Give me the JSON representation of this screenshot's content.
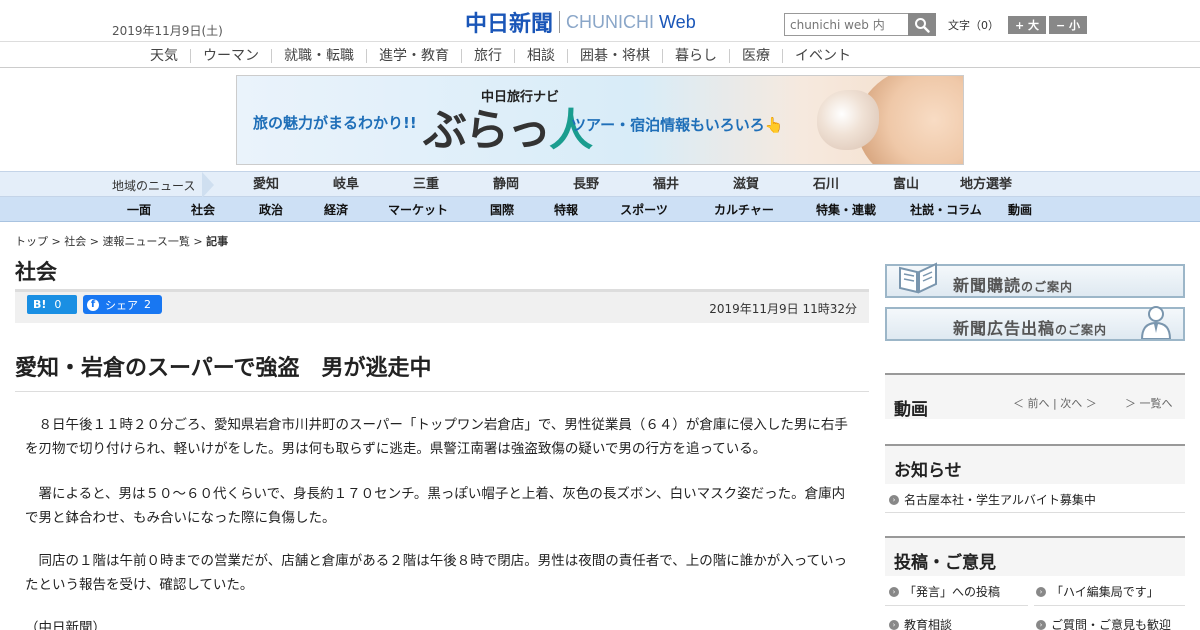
{
  "header": {
    "date": "2019年11月9日(土)",
    "logo_jp": "中日新聞",
    "logo_en_1": "CHUNICHI ",
    "logo_en_2": "Web",
    "search_placeholder": "chunichi web 内",
    "font_label": "文字（0）",
    "font_bigger": "+ 大",
    "font_smaller": "− 小"
  },
  "categories": [
    "天気",
    "ウーマン",
    "就職・転職",
    "進学・教育",
    "旅行",
    "相談",
    "囲碁・将棋",
    "暮らし",
    "医療",
    "イベント"
  ],
  "banner": {
    "subtitle": "中日旅行ナビ",
    "left_text": "旅の魅力がまるわかり!!",
    "logo": "ぶらっ",
    "logo_accent": "人",
    "right_text": "ツアー・宿泊情報もいろいろ👆"
  },
  "region_nav": {
    "label": "地域のニュース",
    "items": [
      "愛知",
      "岐阜",
      "三重",
      "静岡",
      "長野",
      "福井",
      "滋賀",
      "石川",
      "富山",
      "地方選挙"
    ]
  },
  "section_nav": {
    "items": [
      "一面",
      "社会",
      "政治",
      "経済",
      "マーケット",
      "国際",
      "特報",
      "スポーツ",
      "カルチャー",
      "特集・連載",
      "社説・コラム",
      "動画"
    ]
  },
  "article": {
    "breadcrumb": [
      "トップ",
      "社会",
      "速報ニュース一覧",
      "記事"
    ],
    "section": "社会",
    "hatena_label": "B!",
    "hatena_count": "0",
    "facebook_label": "シェア",
    "facebook_count": "2",
    "timestamp": "2019年11月9日 11時32分",
    "headline": "愛知・岩倉のスーパーで強盗　男が逃走中",
    "paragraphs": [
      "　８日午後１１時２０分ごろ、愛知県岩倉市川井町のスーパー「トップワン岩倉店」で、男性従業員（６４）が倉庫に侵入した男に右手を刃物で切り付けられ、軽いけがをした。男は何も取らずに逃走。県警江南署は強盗致傷の疑いで男の行方を追っている。",
      "　署によると、男は５０～６０代くらいで、身長約１７０センチ。黒っぽい帽子と上着、灰色の長ズボン、白いマスク姿だった。倉庫内で男と鉢合わせ、もみ合いになった際に負傷した。",
      "　同店の１階は午前０時までの営業だが、店舗と倉庫がある２階は午後８時で閉店。男性は夜間の責任者で、上の階に誰かが入っていったという報告を受け、確認していた。",
      "（中日新聞）"
    ]
  },
  "sidebar": {
    "banner1_main": "新聞購読",
    "banner1_small": "のご案内",
    "banner2_main": "新聞広告出稿",
    "banner2_small": "のご案内",
    "video_title": "動画",
    "video_prev": "＜ 前へ",
    "video_next": "次へ ＞",
    "video_list": "一覧へ",
    "news_title": "お知らせ",
    "news_items": [
      "名古屋本社・学生アルバイト募集中"
    ],
    "post_title": "投稿・ご意見",
    "post_items": [
      "「発言」への投稿",
      "「ハイ編集局です」",
      "教育相談",
      "ご質問・ご意見も歓迎"
    ]
  },
  "colors": {
    "brand_blue": "#1a56b8",
    "region_bg": "#e4eef9",
    "section_bg": "#cde0f5",
    "hatena_blue": "#1a8fe3",
    "facebook_blue": "#1877f2"
  }
}
